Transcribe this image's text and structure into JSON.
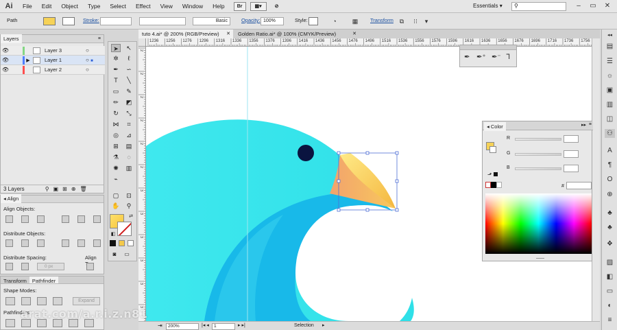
{
  "app": {
    "logo": "Ai"
  },
  "menu": {
    "items": [
      "File",
      "Edit",
      "Object",
      "Type",
      "Select",
      "Effect",
      "View",
      "Window",
      "Help"
    ]
  },
  "workspace": {
    "name": "Essentials",
    "search_placeholder": ""
  },
  "control_bar": {
    "selection_type": "Path",
    "stroke_label": "Stroke:",
    "brush_style": "Basic",
    "opacity_label": "Opacity:",
    "opacity_value": "100%",
    "style_label": "Style:",
    "transform_label": "Transform"
  },
  "doc_tabs": [
    {
      "label": "tuto 4.ai* @ 200% (RGB/Preview)",
      "active": true
    },
    {
      "label": "Golden Ratio.ai* @ 100% (CMYK/Preview)",
      "active": false
    }
  ],
  "ruler": {
    "top_ticks": [
      "1236",
      "1256",
      "1276",
      "1296",
      "1316",
      "1336",
      "1356",
      "1376",
      "1396",
      "1416",
      "1436",
      "1456",
      "1476",
      "1496",
      "1516",
      "1536",
      "1556",
      "1576",
      "1596",
      "1616",
      "1636",
      "1656",
      "1676",
      "1696",
      "1716",
      "1736",
      "1756"
    ],
    "left_ticks": [
      "2",
      "2",
      "2",
      "2",
      "2",
      "2",
      "3",
      "3",
      "3",
      "3",
      "3",
      "3"
    ]
  },
  "layers_panel": {
    "tab": "Layers",
    "layers": [
      {
        "name": "Layer 3",
        "color": "#84d784",
        "selected": false,
        "expanded": false
      },
      {
        "name": "Layer 1",
        "color": "#4f7fff",
        "selected": true,
        "expanded": true
      },
      {
        "name": "Layer 2",
        "color": "#ff4f4f",
        "selected": false,
        "expanded": false
      }
    ],
    "count": "3 Layers"
  },
  "align_panel": {
    "tab": "Align",
    "align_objects": "Align Objects:",
    "distribute_objects": "Distribute Objects:",
    "distribute_spacing": "Distribute Spacing:",
    "align_to": "Align To:",
    "spacing_value": "0 px"
  },
  "pathfinder_panel": {
    "tabs": [
      "Transform",
      "Pathfinder"
    ],
    "shape_modes": "Shape Modes:",
    "pathfinders": "Pathfinders:",
    "expand_label": "Expand"
  },
  "color_panel": {
    "tab": "Color",
    "channels": [
      "R",
      "G",
      "B"
    ],
    "hex_label": "#"
  },
  "status_bar": {
    "zoom": "200%",
    "artboard": "1",
    "tool": "Selection"
  },
  "colors": {
    "bird_body": "#2fe0e8",
    "bird_wing": "#1ab5e8",
    "beak_top": "#f7c94b",
    "beak_bottom": "#f29a6a",
    "eye": "#0a1440",
    "fill_swatch": "#ffe06a",
    "stroke_swatch": "#d01d1d"
  },
  "watermark": "arat.com/a.r.i.z.n81"
}
